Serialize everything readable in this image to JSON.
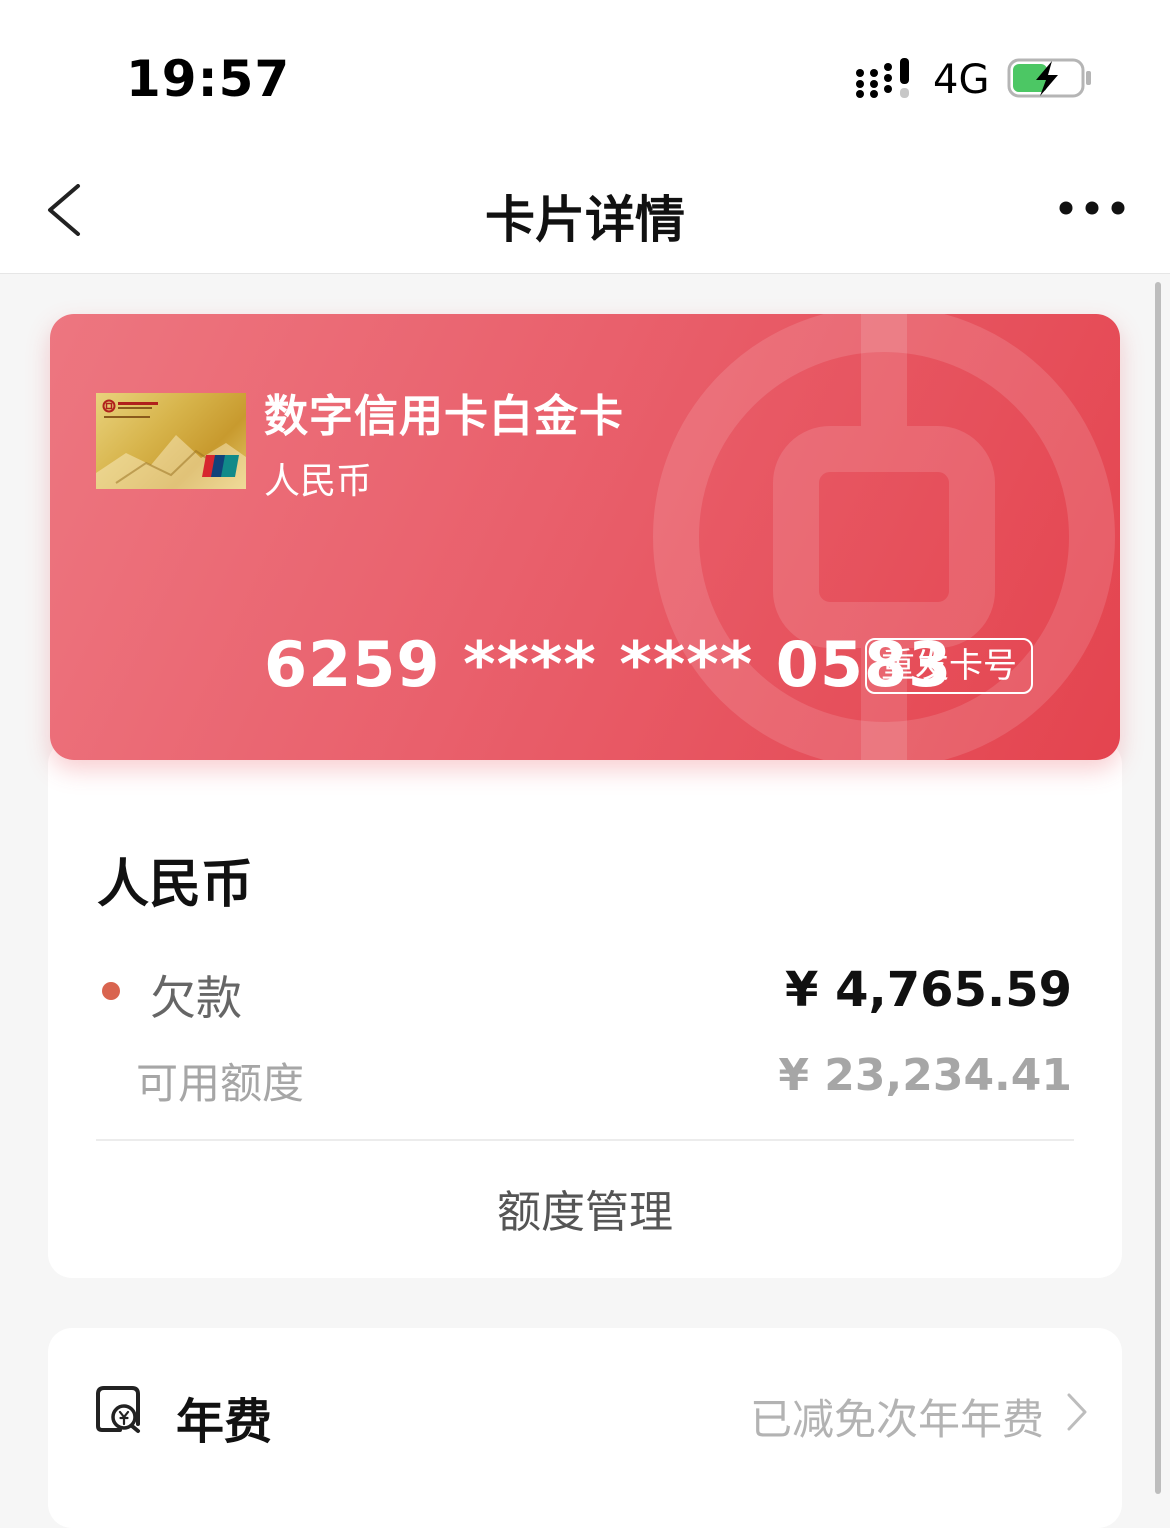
{
  "status_bar": {
    "time": "19:57",
    "network": "4G",
    "signal_icon": "signal-bars-icon",
    "battery_icon": "battery-charging-icon"
  },
  "nav": {
    "title": "卡片详情",
    "back_icon": "chevron-left-icon",
    "more_icon": "more-dots-icon"
  },
  "card": {
    "name": "数字信用卡白金卡",
    "currency": "人民币",
    "number": "6259 **** **** 0583",
    "reissue_label": "重发卡号",
    "gradient_start": "#ed7680",
    "gradient_end": "#e4444f"
  },
  "account": {
    "section_title": "人民币",
    "debt_label": "欠款",
    "debt_value": "¥ 4,765.59",
    "available_label": "可用额度",
    "available_value": "¥ 23,234.41",
    "limit_manage_label": "额度管理",
    "debt_dot_color": "#d9644f"
  },
  "annual_fee": {
    "icon": "fee-document-icon",
    "label": "年费",
    "status": "已减免次年年费",
    "chevron_icon": "chevron-right-icon"
  }
}
